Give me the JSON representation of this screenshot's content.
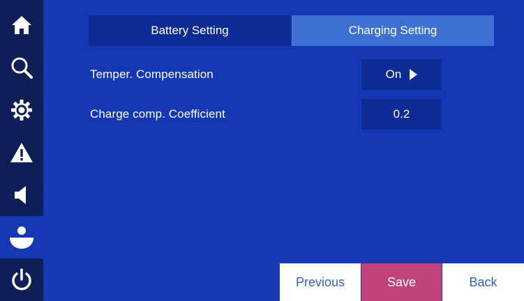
{
  "colors": {
    "background": "#1437b4",
    "sidebar": "#0c2057",
    "tab_inactive": "#0c2b94",
    "tab_active": "#3e70d3",
    "save_button": "#c1437a",
    "button_text": "#3460c8"
  },
  "sidebar": {
    "items": [
      {
        "icon": "home-icon"
      },
      {
        "icon": "search-icon"
      },
      {
        "icon": "gear-icon"
      },
      {
        "icon": "warning-icon"
      },
      {
        "icon": "speaker-icon"
      },
      {
        "icon": "user-icon",
        "active": true
      },
      {
        "icon": "power-icon"
      }
    ]
  },
  "tabs": [
    {
      "label": "Battery Setting",
      "active": false
    },
    {
      "label": "Charging Setting",
      "active": true
    }
  ],
  "settings": [
    {
      "label": "Temper. Compensation",
      "value": "On"
    },
    {
      "label": "Charge comp. Coefficient",
      "value": "0.2"
    }
  ],
  "buttons": {
    "previous": "Previous",
    "save": "Save",
    "back": "Back"
  }
}
